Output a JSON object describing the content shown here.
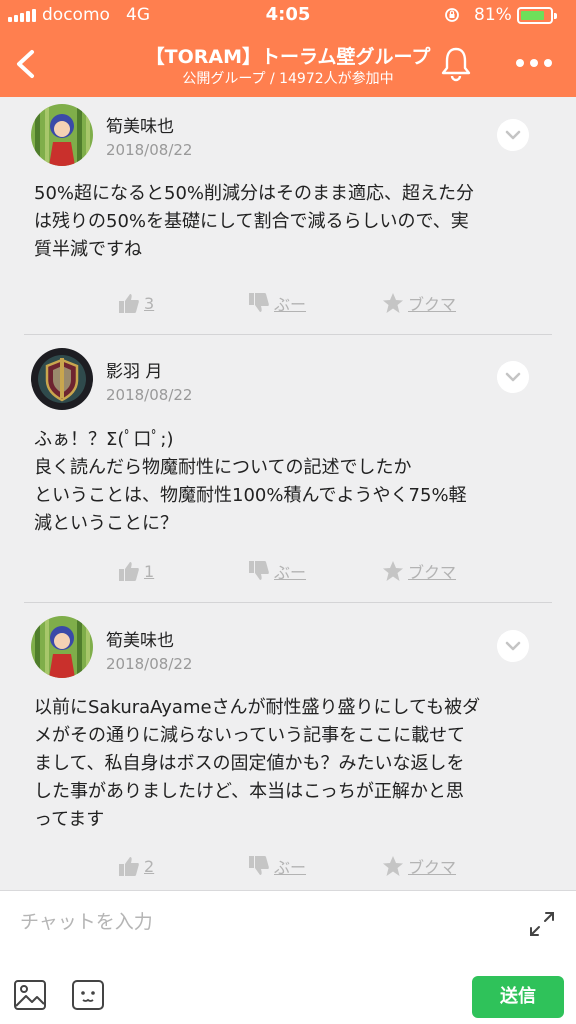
{
  "status_bar": {
    "carrier": "docomo",
    "network": "4G",
    "time": "4:05",
    "battery_percent": "81%",
    "battery_level": 0.81
  },
  "header": {
    "title": "【TORAM】トーラム壁グループ",
    "subtitle": "公開グループ / 14972人が参加中",
    "back_icon": "chevron-left-icon",
    "bell_icon": "bell-icon",
    "more_icon": "more-dots-icon"
  },
  "posts": [
    {
      "author": "筍美味也",
      "date": "2018/08/22",
      "avatar": "anime-character-avatar",
      "text": "50%超になると50%削減分はそのまま適応、超えた分\nは残りの50%を基礎にして割合で減るらしいので、実\n質半減ですね",
      "likes": "3",
      "boo_label": "ぶー",
      "bookmark_label": "ブクマ"
    },
    {
      "author": "影羽 月",
      "date": "2018/08/22",
      "avatar": "shield-emblem-avatar",
      "text": "ふぁ！？Σ(ﾟ口ﾟ;)\n良く読んだら物魔耐性についての記述でしたか\nということは、物魔耐性100%積んでようやく75%軽\n減ということに？",
      "likes": "1",
      "boo_label": "ぶー",
      "bookmark_label": "ブクマ"
    },
    {
      "author": "筍美味也",
      "date": "2018/08/22",
      "avatar": "anime-character-avatar",
      "text": "以前にSakuraAyameさんが耐性盛り盛りにしても被ダ\nメがその通りに減らないっていう記事をここに載せて\nまして、私自身はボスの固定値かも？みたいな返しを\nした事がありましたけど、本当はこっちが正解かと思\nってます",
      "likes": "2",
      "boo_label": "ぶー",
      "bookmark_label": "ブクマ"
    }
  ],
  "composer": {
    "placeholder": "チャットを入力",
    "send_label": "送信"
  },
  "colors": {
    "header_bg": "#ff7f4f",
    "send_bg": "#2fc25a",
    "action_gray": "#b3b3b3"
  }
}
